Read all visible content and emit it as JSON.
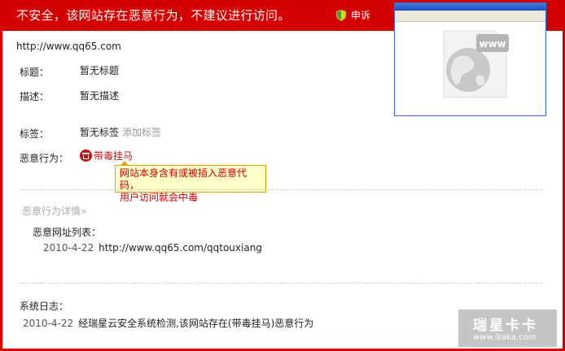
{
  "banner": {
    "warning": "不安全，该网站存在恶意行为，不建议进行访问。",
    "appeal_label": "申诉"
  },
  "site": {
    "url": "http://www.qq65.com"
  },
  "fields": {
    "title_label": "标题：",
    "title_value": "暂无标题",
    "desc_label": "描述：",
    "desc_value": "暂无描述",
    "tag_label": "标签：",
    "tag_value": "暂无标签",
    "add_tag": "添加标签",
    "malicious_label": "恶意行为：",
    "malicious_value": "带毒挂马"
  },
  "tooltip": {
    "line1": "网站本身含有或被插入恶意代码，",
    "line2": "用户访问就会中毒"
  },
  "details": {
    "toggle_label": "恶意行为详情",
    "list_title": "恶意网址列表：",
    "entries": [
      {
        "date": "2010-4-22",
        "url": "http://www.qq65.com/qqtouxiang"
      }
    ]
  },
  "log": {
    "title": "系统日志：",
    "entries": [
      {
        "date": "2010-4-22",
        "text": "经瑞星云安全系统检测,该网站存在(带毒挂马)恶意行为"
      }
    ]
  },
  "preview": {
    "placeholder_text": "www"
  },
  "watermark": {
    "brand": "瑞星卡卡",
    "site": "www.ikaka.com"
  },
  "colors": {
    "banner_red": "#d40000",
    "danger_red": "#c01010",
    "tooltip_bg": "#ffffc7",
    "tooltip_border": "#d9a400"
  },
  "icons": {
    "appeal": "shield-icon",
    "malicious": "trojan-icon",
    "toggle": "double-chevron-down-icon",
    "preview": "globe-icon"
  }
}
